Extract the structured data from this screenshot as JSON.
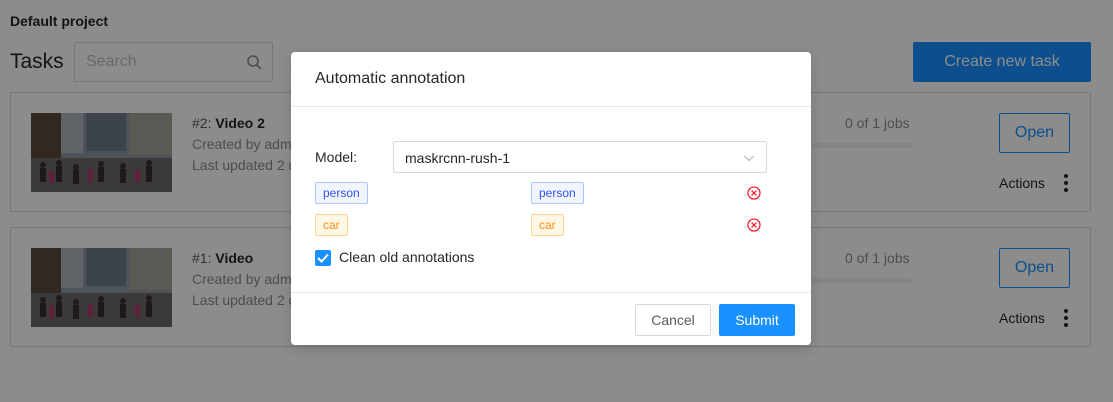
{
  "project": {
    "title": "Default project"
  },
  "tasks_header": {
    "title": "Tasks",
    "search_placeholder": "Search",
    "create_button": "Create new task"
  },
  "tasks": [
    {
      "id_label": "#2:",
      "name": "Video 2",
      "created_by": "Created by adm",
      "updated": "Last updated 2 d",
      "jobs": "0 of 1 jobs",
      "open_label": "Open",
      "actions_label": "Actions",
      "progress": 0
    },
    {
      "id_label": "#1:",
      "name": "Video",
      "created_by": "Created by adm",
      "updated": "Last updated 2 d",
      "jobs": "0 of 1 jobs",
      "open_label": "Open",
      "actions_label": "Actions",
      "progress": 0
    }
  ],
  "modal": {
    "title": "Automatic annotation",
    "model_label": "Model:",
    "model_value": "maskrcnn-rush-1",
    "mappings": [
      {
        "model_label": "person",
        "task_label": "person",
        "color": "#2f54eb"
      },
      {
        "model_label": "car",
        "task_label": "car",
        "color": "#fa8c16"
      }
    ],
    "clean_label": "Clean old annotations",
    "clean_checked": true,
    "cancel_label": "Cancel",
    "submit_label": "Submit"
  },
  "colors": {
    "primary": "#1890ff",
    "danger": "#f5222d"
  }
}
